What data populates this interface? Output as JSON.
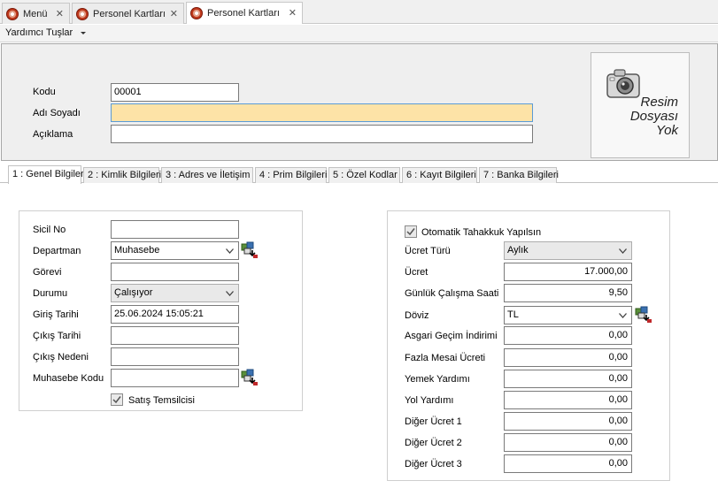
{
  "doc_tabs": [
    {
      "label": "Menü"
    },
    {
      "label": "Personel Kartları"
    },
    {
      "label": "Personel Kartları"
    }
  ],
  "menu": {
    "helper_keys": "Yardımcı Tuşlar"
  },
  "header": {
    "kodu_label": "Kodu",
    "kodu_value": "00001",
    "adi_soyadi_label": "Adı Soyadı",
    "adi_soyadi_value": "",
    "aciklama_label": "Açıklama",
    "aciklama_value": "",
    "photo_text_1": "Resim",
    "photo_text_2": "Dosyası",
    "photo_text_3": "Yok"
  },
  "section_tabs": [
    {
      "label": "1 : Genel Bilgiler"
    },
    {
      "label": "2 : Kimlik Bilgileri"
    },
    {
      "label": "3 : Adres ve İletişim"
    },
    {
      "label": "4 : Prim Bilgileri"
    },
    {
      "label": "5 : Özel Kodlar"
    },
    {
      "label": "6 : Kayıt Bilgileri"
    },
    {
      "label": "7 : Banka Bilgileri"
    }
  ],
  "general": {
    "sicil_no_label": "Sicil No",
    "sicil_no_value": "",
    "departman_label": "Departman",
    "departman_value": "Muhasebe",
    "gorevi_label": "Görevi",
    "gorevi_value": "",
    "durumu_label": "Durumu",
    "durumu_value": "Çalışıyor",
    "giris_tarihi_label": "Giriş Tarihi",
    "giris_tarihi_value": "25.06.2024 15:05:21",
    "cikis_tarihi_label": "Çıkış Tarihi",
    "cikis_tarihi_value": "",
    "cikis_nedeni_label": "Çıkış Nedeni",
    "cikis_nedeni_value": "",
    "muhasebe_kodu_label": "Muhasebe Kodu",
    "muhasebe_kodu_value": "",
    "satis_temsilcisi_label": "Satış Temsilcisi",
    "satis_temsilcisi_checked": true
  },
  "wage": {
    "otomatik_label": "Otomatik Tahakkuk Yapılsın",
    "otomatik_checked": true,
    "ucret_turu_label": "Ücret Türü",
    "ucret_turu_value": "Aylık",
    "ucret_label": "Ücret",
    "ucret_value": "17.000,00",
    "gunluk_label": "Günlük Çalışma Saati",
    "gunluk_value": "9,50",
    "doviz_label": "Döviz",
    "doviz_value": "TL",
    "asgari_label": "Asgari Geçim İndirimi",
    "asgari_value": "0,00",
    "fazla_mesai_label": "Fazla Mesai Ücreti",
    "fazla_mesai_value": "0,00",
    "yemek_label": "Yemek Yardımı",
    "yemek_value": "0,00",
    "yol_label": "Yol Yardımı",
    "yol_value": "0,00",
    "diger1_label": "Diğer Ücret 1",
    "diger1_value": "0,00",
    "diger2_label": "Diğer Ücret 2",
    "diger2_value": "0,00",
    "diger3_label": "Diğer Ücret 3",
    "diger3_value": "0,00"
  },
  "colors": {
    "focused_field": "#fde3a7",
    "focus_border": "#5b9bd5",
    "tab_icon": "#c0391c"
  }
}
